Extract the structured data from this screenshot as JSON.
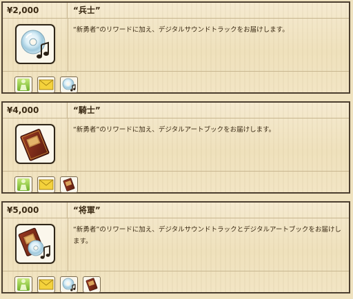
{
  "tiers": [
    {
      "price": "¥2,000",
      "name": "“兵士”",
      "description": "“新勇者”のリワードに加え、デジタルサウンドトラックをお届けします。",
      "image_icon": "soundtrack-cd-icon",
      "reward_icons": [
        "figure-icon",
        "envelope-icon",
        "cd-icon"
      ]
    },
    {
      "price": "¥4,000",
      "name": "“騎士”",
      "description": "“新勇者”のリワードに加え、デジタルアートブックをお届けします。",
      "image_icon": "artbook-icon",
      "reward_icons": [
        "figure-icon",
        "envelope-icon",
        "artbook-icon"
      ]
    },
    {
      "price": "¥5,000",
      "name": "“将軍”",
      "description": "“新勇者”のリワードに加え、デジタルサウンドトラックとデジタルアートブックをお届けします。",
      "image_icon": "artbook-and-cd-icon",
      "reward_icons": [
        "figure-icon",
        "envelope-icon",
        "cd-icon",
        "artbook-icon"
      ]
    }
  ]
}
